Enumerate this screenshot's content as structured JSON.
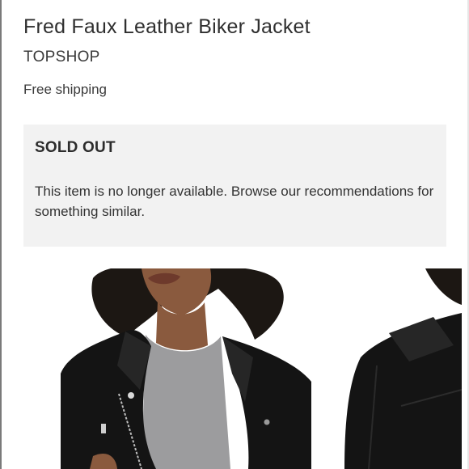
{
  "product": {
    "title": "Fred Faux Leather Biker Jacket",
    "brand": "TOPSHOP",
    "shipping": "Free shipping"
  },
  "availability": {
    "status": "SOLD OUT",
    "message": "This item is no longer available. Browse our recommendations for something similar."
  },
  "colors": {
    "soldout_bg": "#f2f2f2",
    "text": "#333333",
    "jacket": "#141414"
  }
}
